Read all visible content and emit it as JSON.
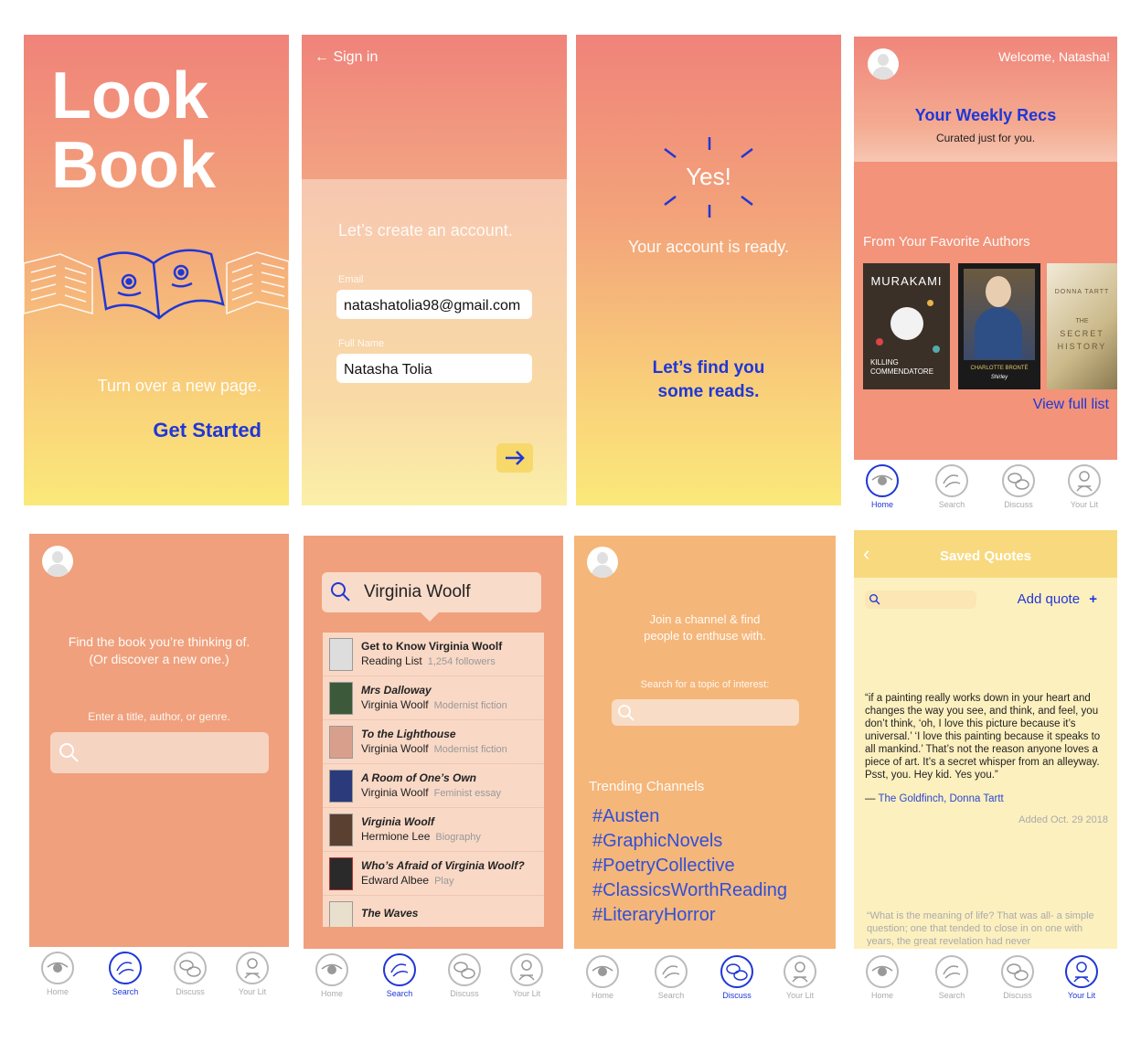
{
  "screen1": {
    "title_line1": "Look",
    "title_line2": "Book",
    "tagline": "Turn over a new page.",
    "cta": "Get Started"
  },
  "screen2": {
    "back": "Sign in",
    "heading": "Let’s create an account.",
    "email_label": "Email",
    "email_value": "natashatolia98@gmail.com",
    "name_label": "Full Name",
    "name_value": "Natasha Tolia"
  },
  "screen3": {
    "yes": "Yes!",
    "ready": "Your account is ready.",
    "find_line1": "Let’s find you",
    "find_line2": "some reads."
  },
  "screen4": {
    "welcome": "Welcome, Natasha!",
    "recs_title": "Your Weekly Recs",
    "recs_sub": "Curated just for you.",
    "section": "From Your Favorite Authors",
    "book1_author": "MURAKAMI",
    "book1_title": "KILLING COMMENDATORE",
    "book2_author": "CHARLOTTE BRONTË",
    "book2_title": "Shirley",
    "book3_author": "DONNA TARTT",
    "book3_title_line1": "THE",
    "book3_title_line2": "SECRET",
    "book3_title_line3": "HISTORY",
    "view_all": "View full list"
  },
  "screen5": {
    "prompt_line1": "Find the book you’re thinking of.",
    "prompt_line2": "(Or discover a new one.)",
    "hint": "Enter a title, author, or genre."
  },
  "screen6": {
    "query": "Virginia Woolf",
    "results": [
      {
        "title": "Get to Know Virginia Woolf",
        "sub": "Reading List",
        "meta": "1,254 followers"
      },
      {
        "title": "Mrs Dalloway",
        "sub": "Virginia Woolf",
        "meta": "Modernist fiction"
      },
      {
        "title": "To the Lighthouse",
        "sub": "Virginia Woolf",
        "meta": "Modernist fiction"
      },
      {
        "title": "A Room of One’s Own",
        "sub": "Virginia Woolf",
        "meta": "Feminist essay"
      },
      {
        "title": "Virginia Woolf",
        "sub": "Hermione Lee",
        "meta": "Biography"
      },
      {
        "title": "Who’s Afraid of Virginia Woolf?",
        "sub": "Edward Albee",
        "meta": "Play"
      },
      {
        "title": "The Waves",
        "sub": "",
        "meta": ""
      }
    ]
  },
  "screen7": {
    "intro_line1": "Join a channel & find",
    "intro_line2": "people to enthuse with.",
    "search_label": "Search for a topic of interest:",
    "trending": "Trending Channels",
    "tags": [
      "#Austen",
      "#GraphicNovels",
      "#PoetryCollective",
      "#ClassicsWorthReading",
      "#LiteraryHorror"
    ]
  },
  "screen8": {
    "title": "Saved Quotes",
    "add": "Add quote",
    "quote": "“if a painting really works down in your heart and changes the way you see, and think, and feel, you don’t think, ‘oh, I love this picture because it’s universal.’ ‘I love this painting because it speaks to all mankind.’ That’s not the reason anyone loves a piece of art. It’s a secret whisper from an alleyway. Psst, you. Hey kid. Yes you.”",
    "source_dash": "—",
    "source": "The Goldfinch, Donna Tartt",
    "added": "Added Oct. 29 2018",
    "quote2": "“What is the meaning of life? That was all- a simple question; one that tended to close in on one with years, the great revelation had never"
  },
  "nav": {
    "home": "Home",
    "search": "Search",
    "discuss": "Discuss",
    "yourlit": "Your Lit"
  },
  "colors": {
    "accent": "#1f37d6",
    "coral": "#f0837a",
    "peach": "#f0a77f",
    "yellow": "#fbe97a"
  }
}
